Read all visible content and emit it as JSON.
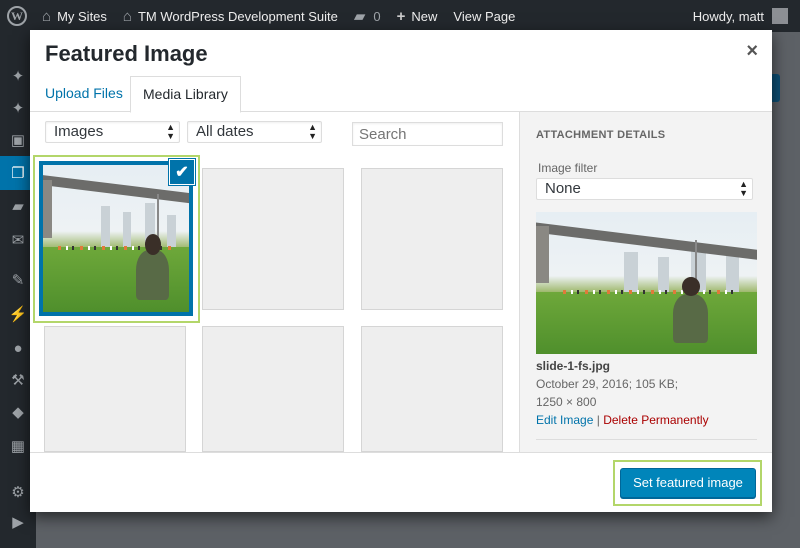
{
  "adminbar": {
    "my_sites": "My Sites",
    "site_name": "TM WordPress Development Suite",
    "comments_count": "0",
    "new_label": "New",
    "view_page": "View Page",
    "greeting": "Howdy, matt"
  },
  "modal": {
    "title": "Featured Image",
    "close_glyph": "×",
    "tabs": {
      "upload": "Upload Files",
      "library": "Media Library"
    }
  },
  "toolbar": {
    "type_filter": "Images",
    "date_filter": "All dates",
    "search_placeholder": "Search"
  },
  "grid": {
    "selected_check": "✔"
  },
  "details": {
    "heading": "ATTACHMENT DETAILS",
    "image_filter_label": "Image filter",
    "image_filter_value": "None",
    "filename": "slide-1-fs.jpg",
    "date_size": "October 29, 2016;  105 KB;",
    "dimensions": "1250 × 800",
    "edit_link": "Edit Image",
    "separator": "|",
    "delete_link": "Delete Permanently"
  },
  "footer": {
    "set_button": "Set featured image"
  },
  "colors": {
    "accent": "#0073aa",
    "primary_button": "#0085ba",
    "highlight_outline": "#b3d66a",
    "delete": "#aa0000"
  }
}
